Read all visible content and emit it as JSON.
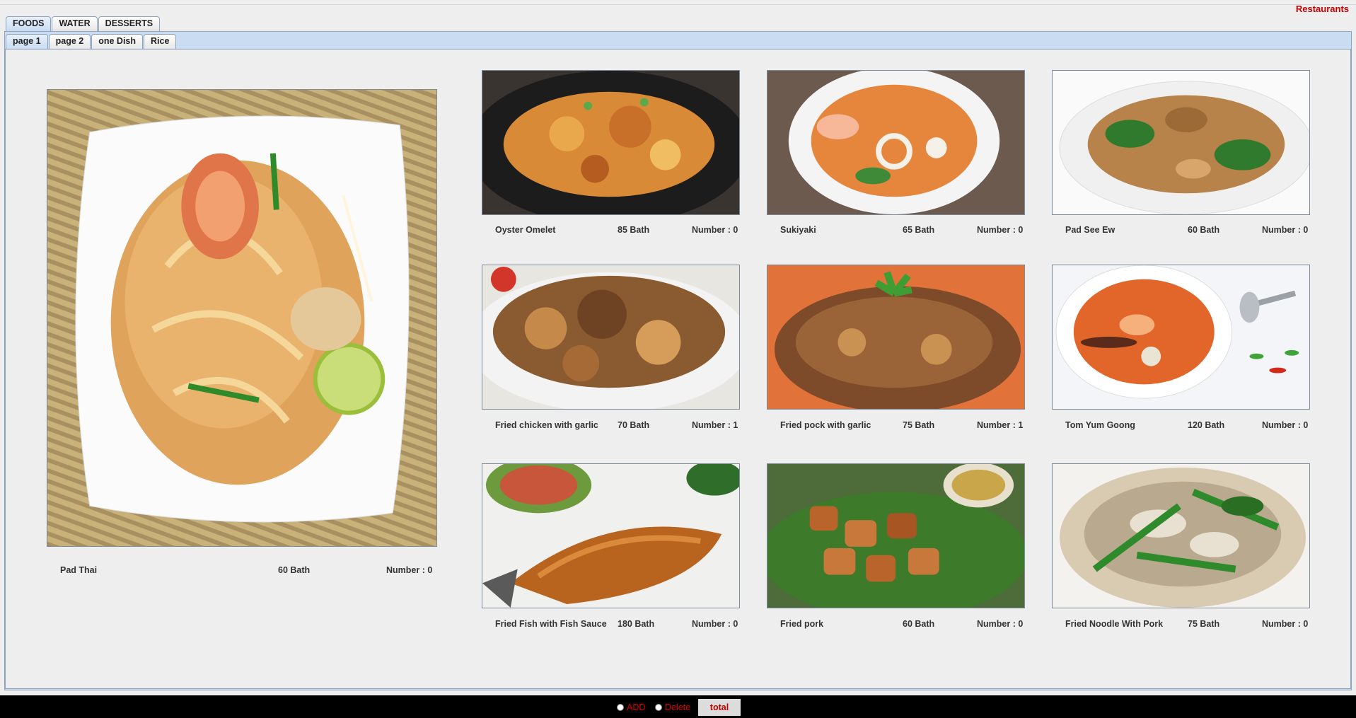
{
  "header": {
    "restaurants_label": "Restaurants"
  },
  "main_tabs": [
    {
      "label": "FOODS",
      "active": true
    },
    {
      "label": "WATER",
      "active": false
    },
    {
      "label": "DESSERTS",
      "active": false
    }
  ],
  "sub_tabs": [
    {
      "label": "page 1",
      "active": true
    },
    {
      "label": "page 2",
      "active": false
    },
    {
      "label": "one Dish",
      "active": false
    },
    {
      "label": "Rice",
      "active": false
    }
  ],
  "featured": {
    "name": "Pad Thai",
    "price": "60 Bath",
    "number": "Number : 0"
  },
  "items": [
    {
      "name": "Oyster Omelet",
      "price": "85 Bath",
      "number": "Number : 0"
    },
    {
      "name": "Sukiyaki",
      "price": "65 Bath",
      "number": "Number : 0"
    },
    {
      "name": "Pad See Ew",
      "price": "60 Bath",
      "number": "Number : 0"
    },
    {
      "name": "Fried chicken with garlic",
      "price": "70 Bath",
      "number": "Number : 1"
    },
    {
      "name": "Fried pock with garlic",
      "price": "75 Bath",
      "number": "Number : 1"
    },
    {
      "name": "Tom Yum Goong",
      "price": "120 Bath",
      "number": "Number : 0"
    },
    {
      "name": "Fried Fish with Fish Sauce",
      "price": "180 Bath",
      "number": "Number : 0"
    },
    {
      "name": "Fried pork",
      "price": "60 Bath",
      "number": "Number : 0"
    },
    {
      "name": "Fried Noodle With Pork",
      "price": "75 Bath",
      "number": "Number : 0"
    }
  ],
  "bottom": {
    "add_label": "ADD",
    "delete_label": "Delete",
    "total_label": "total"
  },
  "colors": {
    "accent_red": "#c00000",
    "tab_blue": "#c9dcf2",
    "border_blue": "#8fa3bc"
  }
}
